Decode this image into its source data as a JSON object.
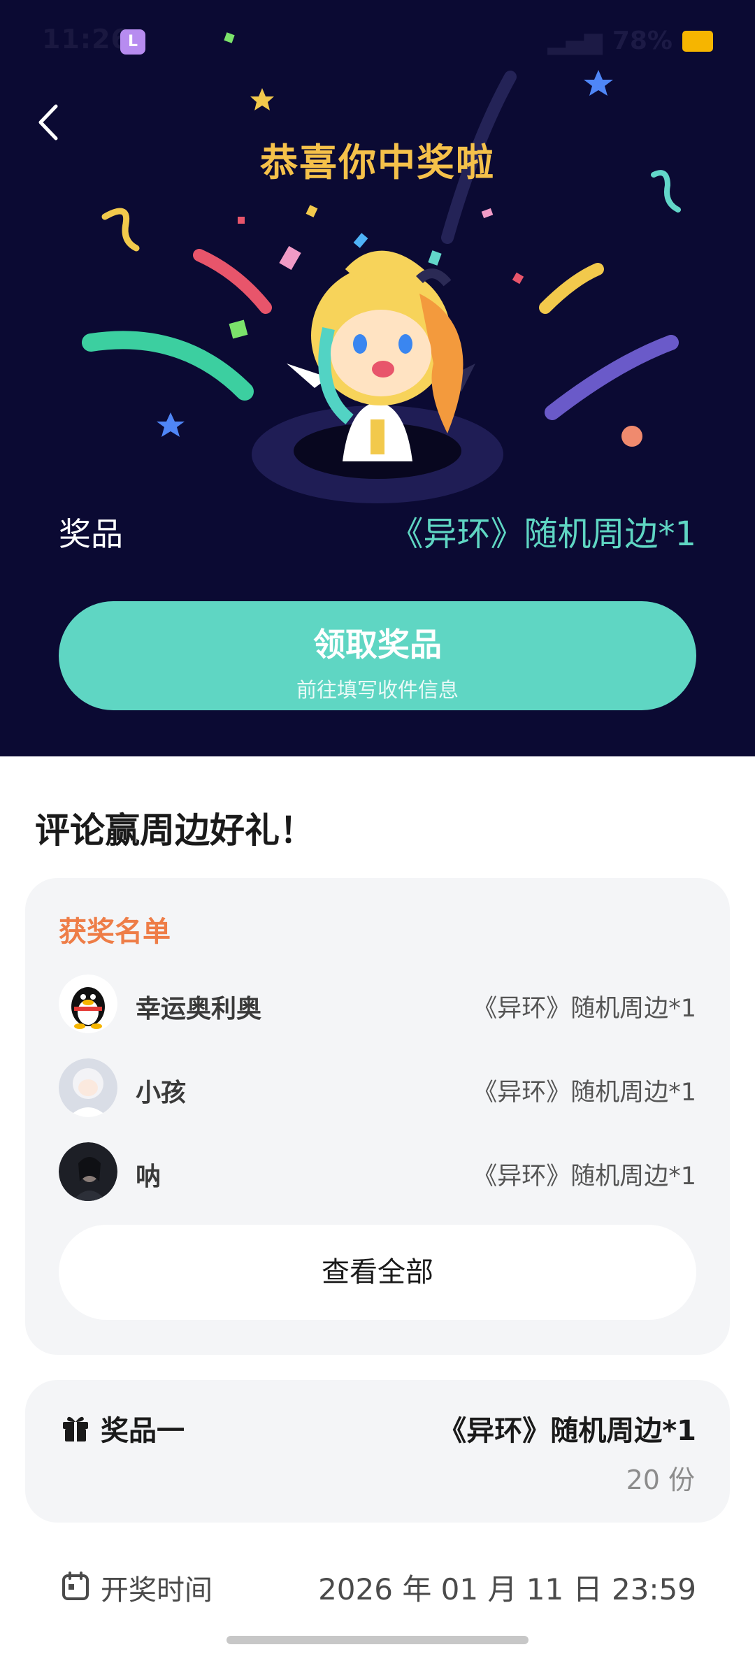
{
  "status_bar": {
    "time": "11:26",
    "app_icon": "lc-app-icon",
    "battery_percent": "78%",
    "battery_color": "#f6b500"
  },
  "header": {
    "back_icon": "chevron-left-icon",
    "title": "恭喜你中奖啦"
  },
  "prize": {
    "label": "奖品",
    "value": "《异环》随机周边*1"
  },
  "claim_button": {
    "title": "领取奖品",
    "subtitle": "前往填写收件信息",
    "color": "#5fd6c3"
  },
  "section": {
    "title": "评论赢周边好礼！"
  },
  "winners": {
    "title": "获奖名单",
    "title_color": "#ee7d47",
    "rows": [
      {
        "name": "幸运奥利奥",
        "prize": "《异环》随机周边*1",
        "avatar": "penguin-avatar"
      },
      {
        "name": "小孩",
        "prize": "《异环》随机周边*1",
        "avatar": "white-hair-girl-avatar"
      },
      {
        "name": "呐",
        "prize": "《异环》随机周边*1",
        "avatar": "dark-portrait-avatar"
      }
    ],
    "view_all_label": "查看全部"
  },
  "prize_detail": {
    "icon": "gift-icon",
    "label": "奖品一",
    "name": "《异环》随机周边*1",
    "count": "20 份"
  },
  "draw_time": {
    "icon": "calendar-icon",
    "label": "开奖时间",
    "value": "2026 年 01 月 11 日 23:59"
  },
  "colors": {
    "hero_bg": "#0b0a33",
    "accent_teal": "#5fd6c3",
    "title_gold": "#f5c14a"
  }
}
